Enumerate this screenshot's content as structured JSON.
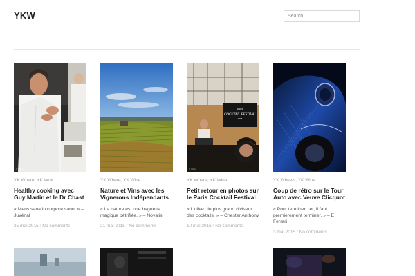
{
  "site": {
    "title": "YKW"
  },
  "search": {
    "placeholder": "Search"
  },
  "posts": [
    {
      "categories": [
        "YK Where",
        "YK Wok"
      ],
      "title": "Healthy cooking avec Guy Martin et le Dr Chast",
      "excerpt": "« Mens sana in corpore sano. » – Juvénal",
      "date": "25 mai 2015",
      "comments": "No comments"
    },
    {
      "categories": [
        "YK Where",
        "YK Wine"
      ],
      "title": "Nature et Vins avec les Vignerons Indépendants",
      "excerpt": "« La nature est une baguette magique pétrifiée. » – Novalis",
      "date": "21 mai 2015",
      "comments": "No comments"
    },
    {
      "categories": [
        "YK Where",
        "YK Wine"
      ],
      "title": "Petit retour en photos sur le Paris Cocktail Festival",
      "excerpt": "« L'olive : le plus grand diviseur des cocktails. » – Chester Anthony",
      "date": "10 mai 2015",
      "comments": "No comments",
      "image_sign": {
        "line1": "PARIS",
        "line2": "COCKTAIL FESTIVAL",
        "line3": "2015"
      }
    },
    {
      "categories": [
        "YK Wheels",
        "YK Wine"
      ],
      "title": "Coup de rétro sur le Tour Auto avec Veuve Clicquot",
      "excerpt": "« Pour terminer 1er, il faut premièrement terminer. » – E Ferrari",
      "date": "3 mai 2015",
      "comments": "No comments"
    }
  ]
}
